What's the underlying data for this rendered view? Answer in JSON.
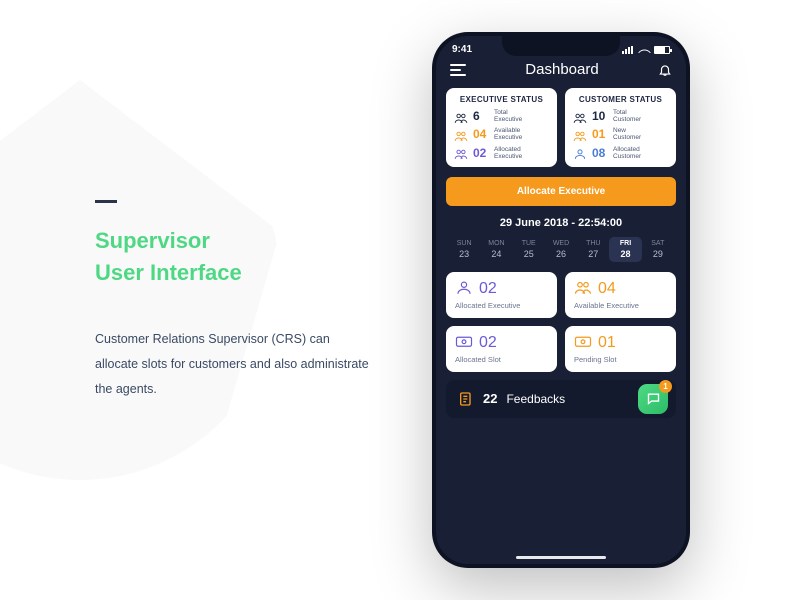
{
  "left": {
    "title_line1": "Supervisor",
    "title_line2": "User Interface",
    "description": "Customer Relations Supervisor (CRS) can allocate slots for customers and also administrate the agents."
  },
  "status": {
    "time": "9:41"
  },
  "topbar": {
    "title": "Dashboard"
  },
  "exec_card": {
    "title": "EXECUTIVE STATUS",
    "stats": [
      {
        "value": "6",
        "label_l1": "Total",
        "label_l2": "Executive",
        "color": "dark",
        "icon": "people-icon"
      },
      {
        "value": "04",
        "label_l1": "Available",
        "label_l2": "Executive",
        "color": "orange",
        "icon": "people-icon"
      },
      {
        "value": "02",
        "label_l1": "Allocated",
        "label_l2": "Executive",
        "color": "purple",
        "icon": "people-icon"
      }
    ]
  },
  "cust_card": {
    "title": "CUSTOMER STATUS",
    "stats": [
      {
        "value": "10",
        "label_l1": "Total",
        "label_l2": "Customer",
        "color": "dark",
        "icon": "group-icon"
      },
      {
        "value": "01",
        "label_l1": "New",
        "label_l2": "Customer",
        "color": "orange",
        "icon": "group-icon"
      },
      {
        "value": "08",
        "label_l1": "Allocated",
        "label_l2": "Customer",
        "color": "blue",
        "icon": "person-icon"
      }
    ]
  },
  "allocate_label": "Allocate Executive",
  "datetime": "29 June 2018 - 22:54:00",
  "calendar": [
    {
      "dow": "SUN",
      "num": "23",
      "active": false
    },
    {
      "dow": "MON",
      "num": "24",
      "active": false
    },
    {
      "dow": "TUE",
      "num": "25",
      "active": false
    },
    {
      "dow": "WED",
      "num": "26",
      "active": false
    },
    {
      "dow": "THU",
      "num": "27",
      "active": false
    },
    {
      "dow": "FRI",
      "num": "28",
      "active": true
    },
    {
      "dow": "SAT",
      "num": "29",
      "active": false
    }
  ],
  "tiles": [
    {
      "value": "02",
      "label": "Allocated Executive",
      "color": "purple",
      "icon": "person-icon"
    },
    {
      "value": "04",
      "label": "Available Executive",
      "color": "orange",
      "icon": "people-icon"
    },
    {
      "value": "02",
      "label": "Allocated Slot",
      "color": "purple",
      "icon": "slot-icon"
    },
    {
      "value": "01",
      "label": "Pending Slot",
      "color": "orange",
      "icon": "slot-icon"
    }
  ],
  "feedback": {
    "count": "22",
    "label": "Feedbacks",
    "badge": "1"
  }
}
